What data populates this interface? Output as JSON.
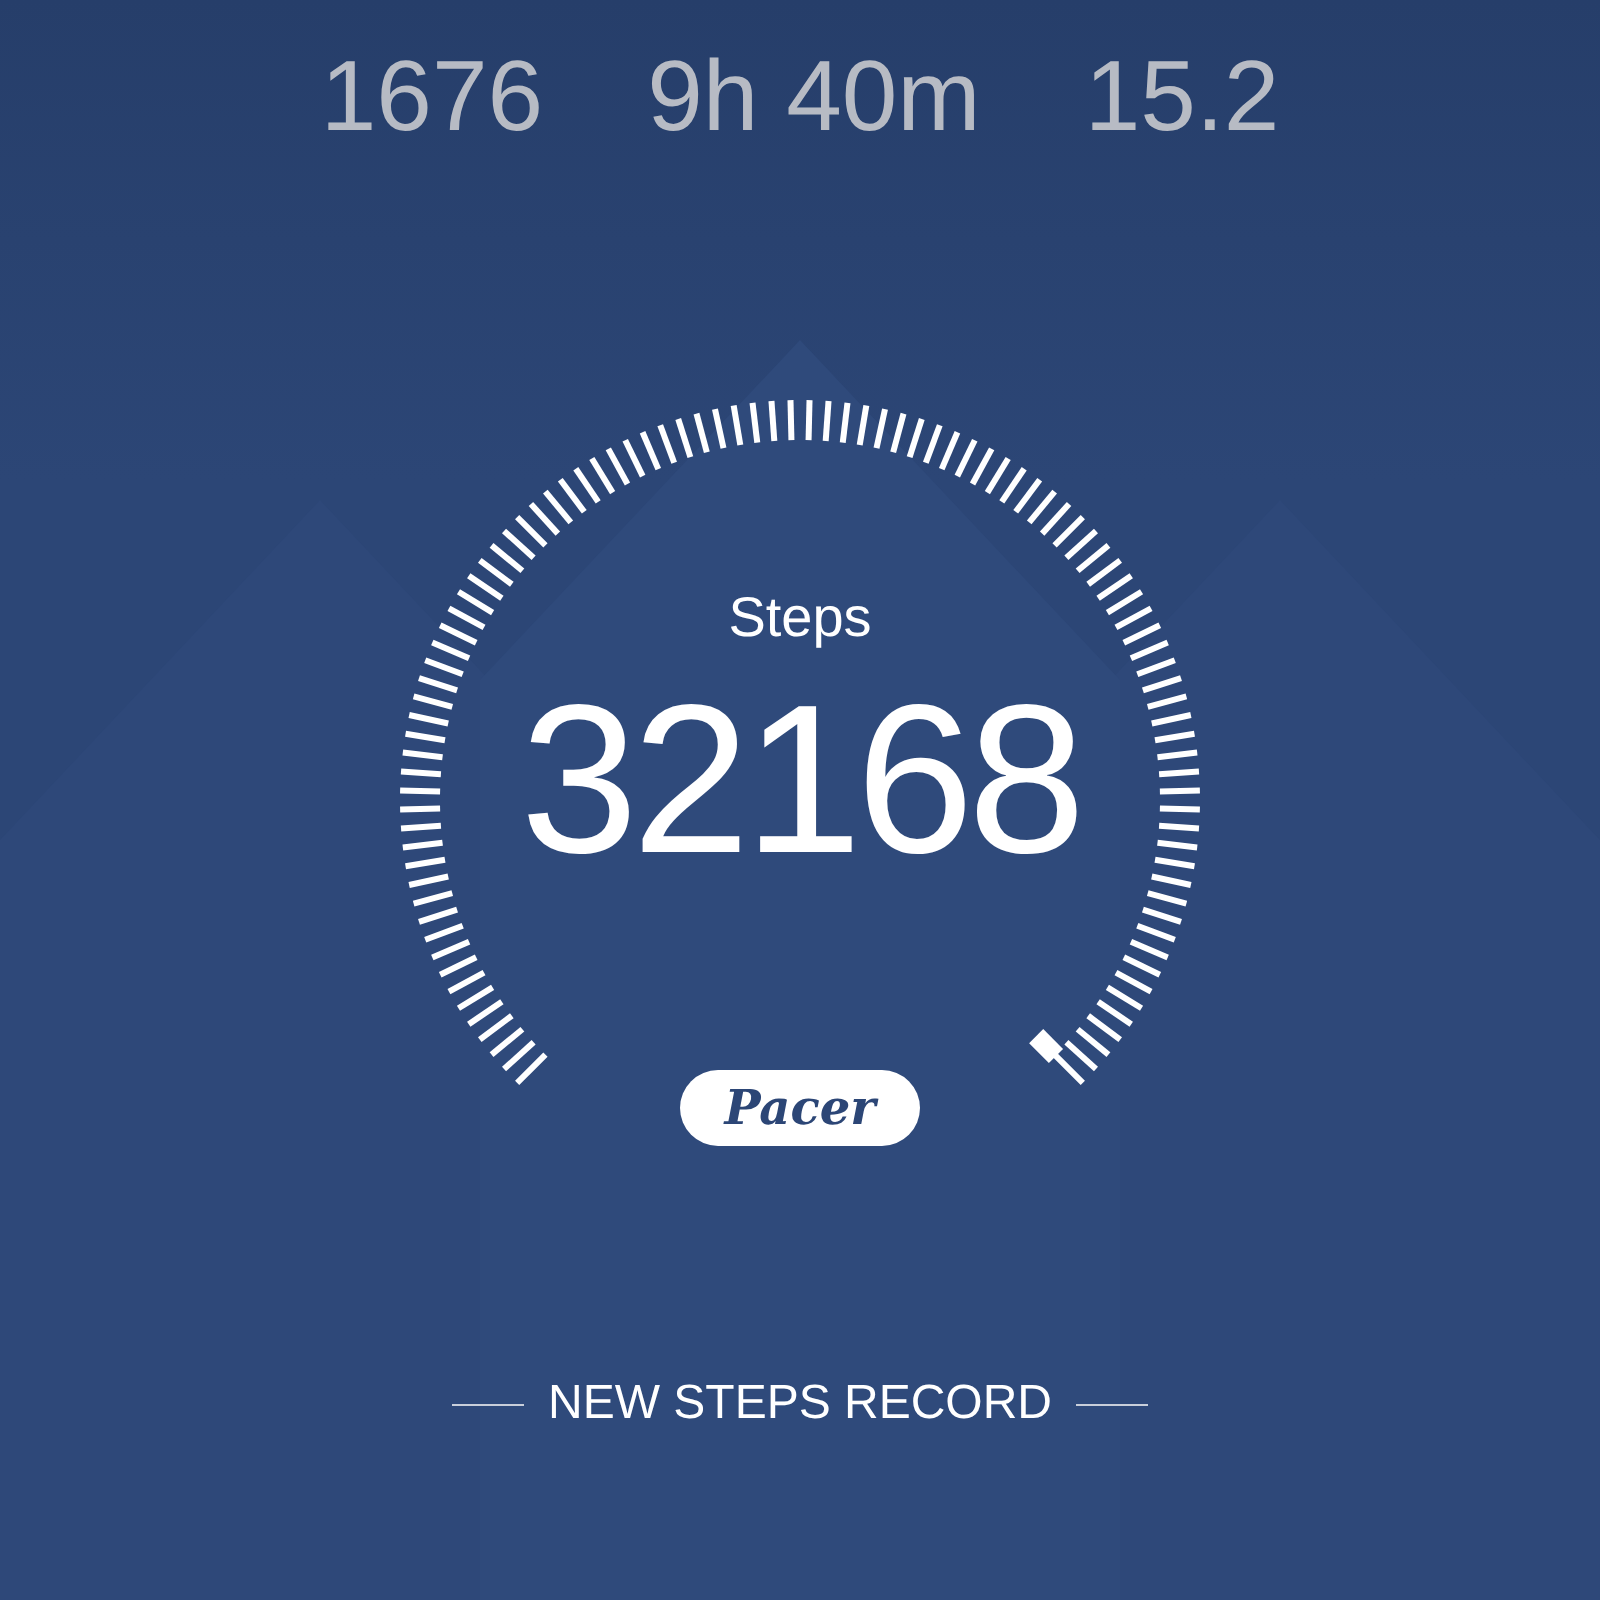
{
  "stats": [
    {
      "value": "1676"
    },
    {
      "value": "9h 40m"
    },
    {
      "value": "15.2"
    }
  ],
  "gauge": {
    "label": "Steps",
    "value": "32168",
    "brand": "Pacer"
  },
  "record": {
    "text": "NEW STEPS RECORD"
  }
}
